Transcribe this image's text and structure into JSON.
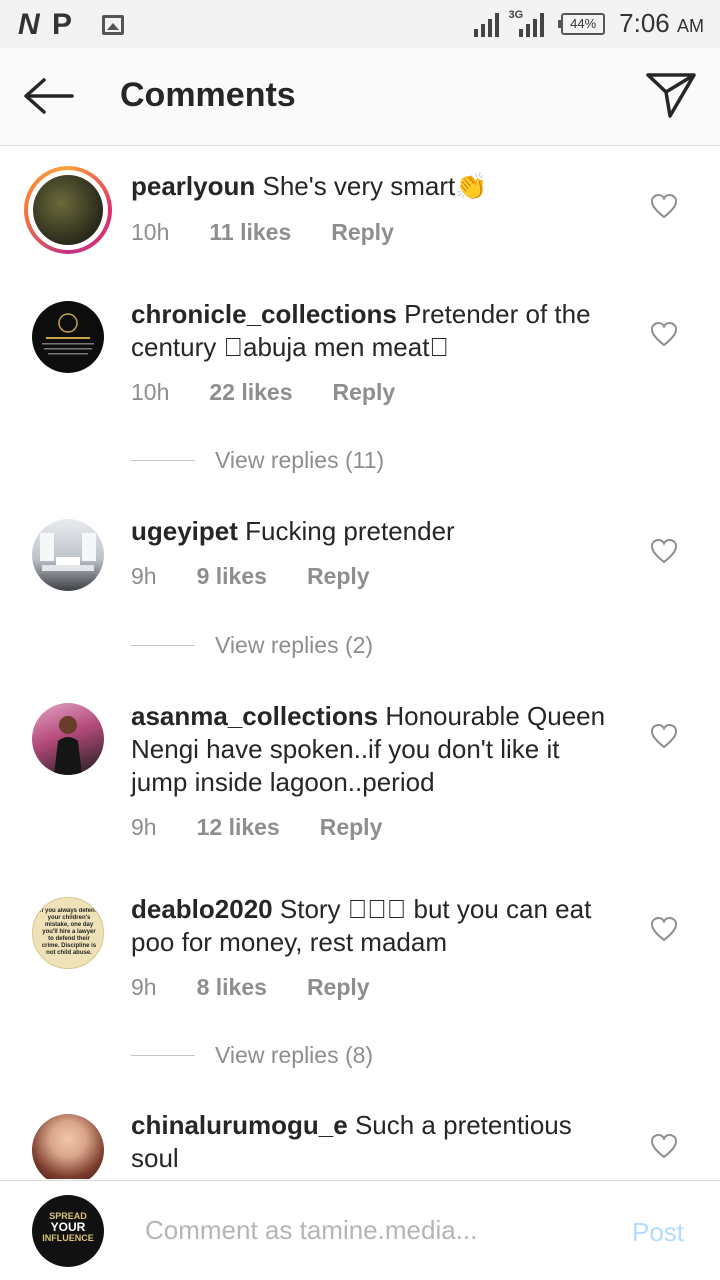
{
  "status_bar": {
    "left_icons": [
      "N",
      "P"
    ],
    "network": "3G",
    "battery": "44%",
    "time": "7:06",
    "ampm": "AM"
  },
  "header": {
    "title": "Comments",
    "back_icon": "arrow-left-icon",
    "share_icon": "paper-plane-icon"
  },
  "comments": [
    {
      "username": "pearlyoun",
      "text": "She's very smart👏",
      "time": "10h",
      "likes": "11 likes",
      "reply": "Reply",
      "avatar_color": "#3b3f2a"
    },
    {
      "username": "chronicle_collections",
      "text": "Pretender of the century \u0000abuja men meat\u0000",
      "time": "10h",
      "likes": "22 likes",
      "reply": "Reply",
      "view_replies": "View replies (11)",
      "avatar_color": "#0d0d0d"
    },
    {
      "username": "ugeyipet",
      "text": "Fucking pretender",
      "time": "9h",
      "likes": "9 likes",
      "reply": "Reply",
      "view_replies": "View replies (2)",
      "avatar_color": "#c9cdd4"
    },
    {
      "username": "asanma_collections",
      "text": "Honourable Queen Nengi have spoken..if you don't like it jump inside lagoon..period",
      "time": "9h",
      "likes": "12 likes",
      "reply": "Reply",
      "avatar_color": "#b44a7a"
    },
    {
      "username": "deablo2020",
      "text": "Story \u0000\u0000\u0000 but you can eat poo for money, rest madam",
      "time": "9h",
      "likes": "8 likes",
      "reply": "Reply",
      "view_replies": "View replies (8)",
      "avatar_color": "#efe2b8",
      "avatar_text": "if you always defend your children's mistake, one day you'll hire a lawyer to defend their crime. Discipline is not child abuse."
    },
    {
      "username": "chinalurumogu_e",
      "text": "Such a pretentious soul",
      "avatar_color": "#d9a58a"
    }
  ],
  "composer": {
    "placeholder": "Comment as tamine.media...",
    "post_label": "Post",
    "avatar_text_top": "SPREAD",
    "avatar_text_mid": "YOUR",
    "avatar_text_bottom": "INFLUENCE"
  },
  "colors": {
    "meta_gray": "#8e8e8e",
    "post_disabled": "#b3dbff",
    "story_ring": "#e1306c"
  }
}
